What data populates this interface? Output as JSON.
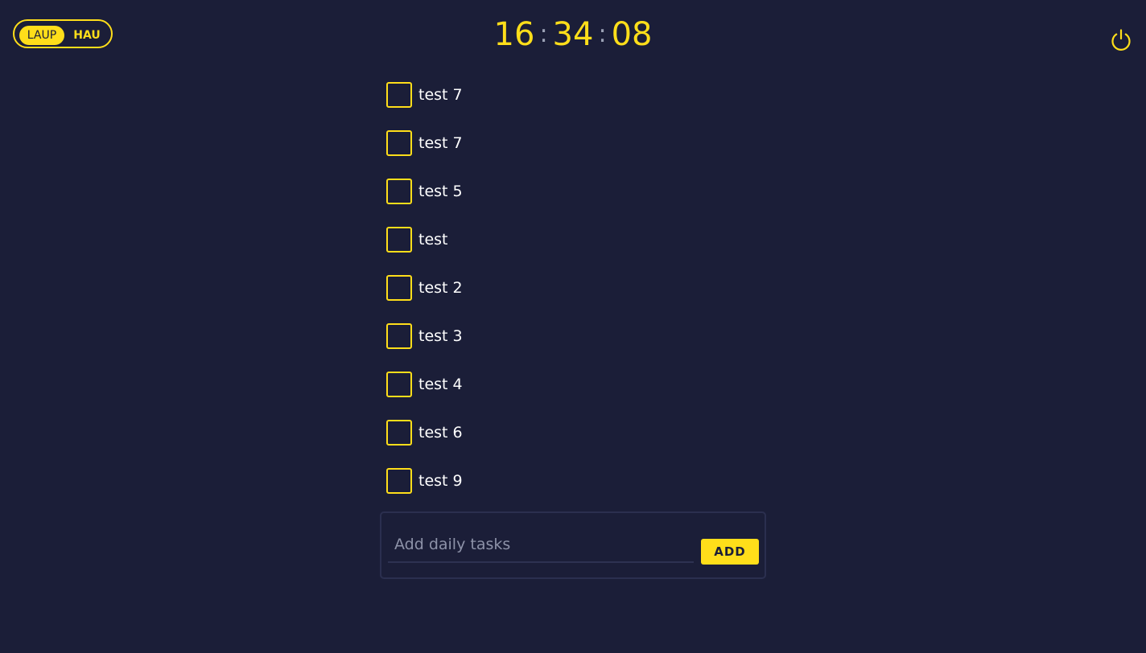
{
  "mode_toggle": {
    "options": [
      "LAUP",
      "HAU"
    ],
    "selected": "LAUP"
  },
  "clock": {
    "hours": "16",
    "minutes": "34",
    "seconds": "08",
    "separator": ":"
  },
  "power_icon": "power-icon",
  "tasks": [
    {
      "label": "test 7",
      "checked": false
    },
    {
      "label": "test 7",
      "checked": false
    },
    {
      "label": "test 5",
      "checked": false
    },
    {
      "label": "test",
      "checked": false
    },
    {
      "label": "test 2",
      "checked": false
    },
    {
      "label": "test 3",
      "checked": false
    },
    {
      "label": "test 4",
      "checked": false
    },
    {
      "label": "test 6",
      "checked": false
    },
    {
      "label": "test 9",
      "checked": false
    }
  ],
  "add_form": {
    "placeholder": "Add daily tasks",
    "value": "",
    "button_label": "ADD"
  },
  "colors": {
    "background": "#1b1e38",
    "accent": "#ffde1a",
    "text": "#ffffff",
    "muted": "#8d92a8"
  }
}
